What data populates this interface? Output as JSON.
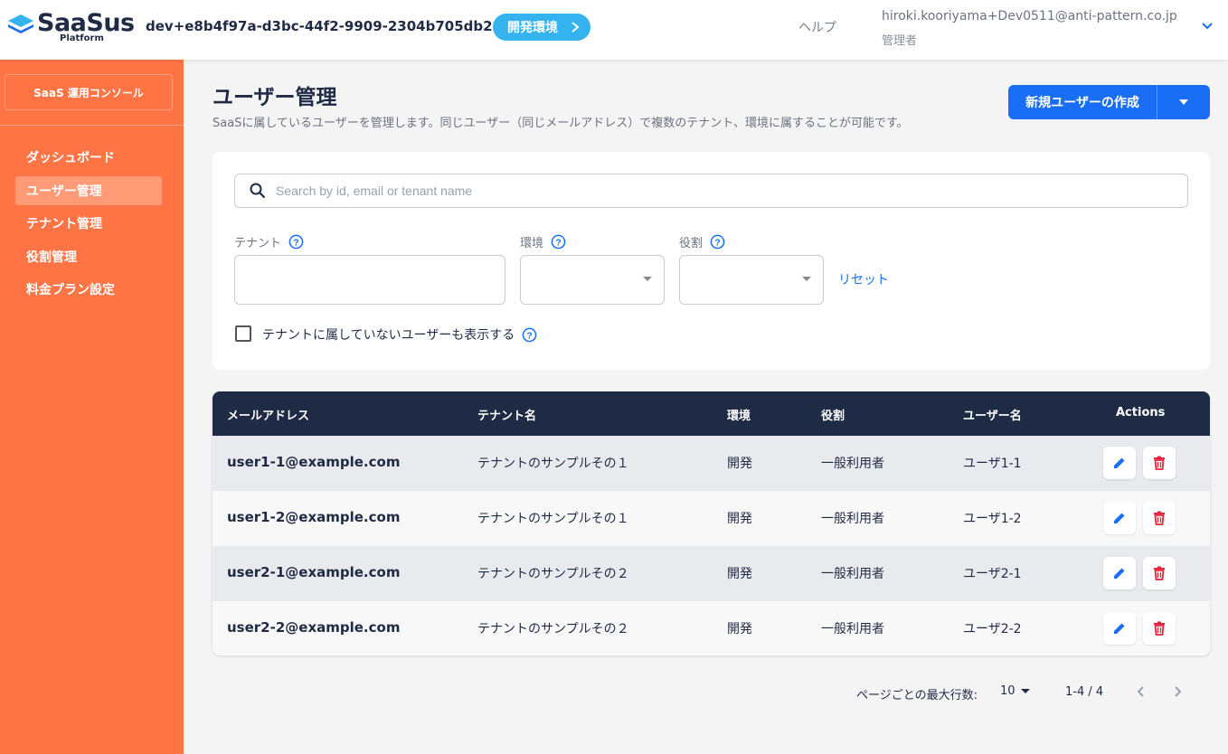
{
  "header": {
    "logo_text": "SaaSus",
    "logo_sub": "Platform",
    "env_id": "dev+e8b4f97a-d3bc-44f2-9909-2304b705db28",
    "env_badge": "開発環境",
    "help": "ヘルプ",
    "user_email": "hiroki.kooriyama+Dev0511@anti-pattern.co.jp",
    "user_role": "管理者"
  },
  "sidebar": {
    "console_button": "SaaS 運用コンソール",
    "items": [
      {
        "label": "ダッシュボード"
      },
      {
        "label": "ユーザー管理",
        "active": true
      },
      {
        "label": "テナント管理"
      },
      {
        "label": "役割管理"
      },
      {
        "label": "料金プラン設定"
      }
    ]
  },
  "main": {
    "title": "ユーザー管理",
    "description": "SaaSに属しているユーザーを管理します。同じユーザー（同じメールアドレス）で複数のテナント、環境に属することが可能です。",
    "create_button": "新規ユーザーの作成"
  },
  "filters": {
    "search_placeholder": "Search by id, email or tenant name",
    "tenant_label": "テナント",
    "env_label": "環境",
    "role_label": "役割",
    "reset": "リセット",
    "checkbox_label": "テナントに属していないユーザーも表示する"
  },
  "table": {
    "columns": [
      "メールアドレス",
      "テナント名",
      "環境",
      "役割",
      "ユーザー名",
      "Actions"
    ],
    "rows": [
      {
        "email": "user1-1@example.com",
        "tenant": "テナントのサンプルその１",
        "env": "開発",
        "role": "一般利用者",
        "name": "ユーザ1-1"
      },
      {
        "email": "user1-2@example.com",
        "tenant": "テナントのサンプルその１",
        "env": "開発",
        "role": "一般利用者",
        "name": "ユーザ1-2"
      },
      {
        "email": "user2-1@example.com",
        "tenant": "テナントのサンプルその２",
        "env": "開発",
        "role": "一般利用者",
        "name": "ユーザ2-1"
      },
      {
        "email": "user2-2@example.com",
        "tenant": "テナントのサンプルその２",
        "env": "開発",
        "role": "一般利用者",
        "name": "ユーザ2-2"
      }
    ]
  },
  "pagination": {
    "rows_per_page_label": "ページごとの最大行数:",
    "rows_per_page": "10",
    "range": "1-4 / 4"
  },
  "colors": {
    "sidebar": "#ff7445",
    "accent": "#1a6ef5",
    "env_badge": "#35b3ee",
    "table_header": "#1f2a44",
    "delete": "#e5243b"
  }
}
